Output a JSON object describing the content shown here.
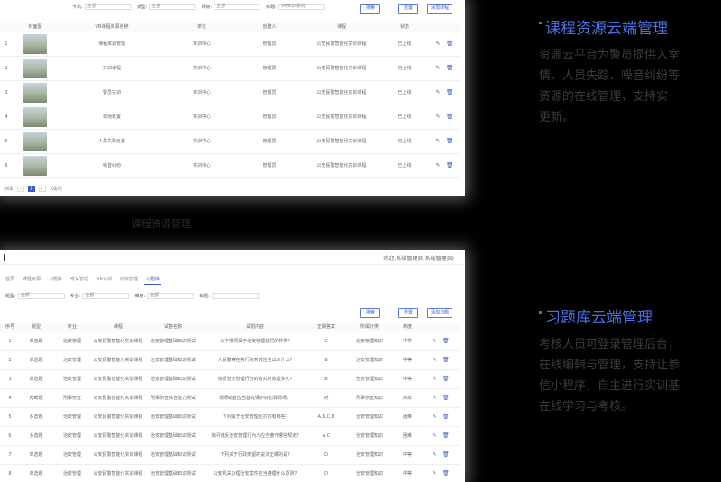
{
  "shot1": {
    "filters": [
      {
        "label": "卡机:",
        "value": "全部"
      },
      {
        "label": "类型:",
        "value": "全部"
      },
      {
        "label": "评级:",
        "value": "全部"
      },
      {
        "label": "标题:",
        "value": "VR实训系统"
      }
    ],
    "buttons": [
      "搜索",
      "重置",
      "添加课程"
    ],
    "columns": [
      "",
      "封面图",
      "VR课程资源名称",
      "单位",
      "创建人",
      "课程",
      "状态",
      ""
    ],
    "rows": [
      {
        "no": "1",
        "name": "课程资源管理",
        "unit": "实训中心",
        "creator": "管理员",
        "course": "公安民警智能化实训课程",
        "status": "已上线"
      },
      {
        "no": "2",
        "name": "实训课程",
        "unit": "实训中心",
        "creator": "管理员",
        "course": "公安民警智能化实训课程",
        "status": "已上线"
      },
      {
        "no": "3",
        "name": "警员实训",
        "unit": "实训中心",
        "creator": "管理员",
        "course": "公安民警智能化实训课程",
        "status": "已上线"
      },
      {
        "no": "4",
        "name": "现场处置",
        "unit": "实训中心",
        "creator": "管理员",
        "course": "公安民警智能化实训课程",
        "status": "已上线"
      },
      {
        "no": "5",
        "name": "人员失踪处置",
        "unit": "实训中心",
        "creator": "管理员",
        "course": "公安民警智能化实训课程",
        "status": "已上线"
      },
      {
        "no": "6",
        "name": "噪音纠纷",
        "unit": "实训中心",
        "creator": "管理员",
        "course": "公安民警智能化实训课程",
        "status": "已上线"
      }
    ],
    "pager": {
      "total": "共6条",
      "page": "1",
      "size": "10条/页"
    }
  },
  "caption": "课程资源管理",
  "shot2": {
    "user": "欢迎,系统管理员(系统管理员)",
    "tabs": [
      "首页",
      "课程资源",
      "习题库",
      "考试管理",
      "VR实训",
      "成绩管理",
      "习题库"
    ],
    "filters": [
      {
        "label": "题型:",
        "value": "全部"
      },
      {
        "label": "专业:",
        "value": "全部"
      },
      {
        "label": "难度:",
        "value": "全部"
      },
      {
        "label": "标题:",
        "value": ""
      }
    ],
    "buttons": [
      "搜索",
      "重置",
      "添加习题"
    ],
    "columns": [
      "序号",
      "题型",
      "专业",
      "课程",
      "试卷名称",
      "试题内容",
      "正确答案",
      "所属分类",
      "难度",
      ""
    ],
    "rows": [
      {
        "no": "1",
        "type": "单选题",
        "major": "治安管理",
        "course": "公安民警智能化实训课程",
        "paper": "治安管理基础知识测试",
        "content": "以下哪项属于治安管理处罚的种类?",
        "answer": "C",
        "cat": "治安管理知识",
        "level": "中等"
      },
      {
        "no": "2",
        "type": "单选题",
        "major": "治安管理",
        "course": "公安民警智能化实训课程",
        "paper": "治安管理基础知识测试",
        "content": "人民警察在执行职务时应当出示什么?",
        "answer": "B",
        "cat": "治安管理知识",
        "level": "中等"
      },
      {
        "no": "3",
        "type": "单选题",
        "major": "治安管理",
        "course": "公安民警智能化实训课程",
        "paper": "治安管理基础知识测试",
        "content": "违反治安管理行为的追究时效是多久?",
        "answer": "B",
        "cat": "治安管理知识",
        "level": "中等"
      },
      {
        "no": "4",
        "type": "判断题",
        "major": "刑事侦查",
        "course": "公安民警智能化实训课程",
        "paper": "刑事侦查综合能力测试",
        "content": "现场勘查应当首先保护好犯罪现场。",
        "answer": "对",
        "cat": "刑事侦查知识",
        "level": "简单"
      },
      {
        "no": "5",
        "type": "多选题",
        "major": "治安管理",
        "course": "公安民警智能化实训课程",
        "paper": "治安管理基础知识测试",
        "content": "下列属于治安管理处罚的有哪些?",
        "answer": "A,B,C,D",
        "cat": "治安管理知识",
        "level": "困难"
      },
      {
        "no": "6",
        "type": "多选题",
        "major": "治安管理",
        "course": "公安民警智能化实训课程",
        "paper": "治安管理基础知识测试",
        "content": "询问违反治安管理行为人应当遵守哪些规定?",
        "answer": "A,C",
        "cat": "治安管理知识",
        "level": "困难"
      },
      {
        "no": "7",
        "type": "单选题",
        "major": "治安管理",
        "course": "公安民警智能化实训课程",
        "paper": "治安管理基础知识测试",
        "content": "下列关于行政拘留的说法正确的是?",
        "answer": "D",
        "cat": "治安管理知识",
        "level": "中等"
      },
      {
        "no": "8",
        "type": "单选题",
        "major": "治安管理",
        "course": "公安民警智能化实训课程",
        "paper": "治安管理基础知识测试",
        "content": "公安机关办理治安案件应当遵循什么原则?",
        "answer": "D",
        "cat": "治安管理知识",
        "level": "中等"
      }
    ]
  },
  "sections": [
    {
      "title": "课程资源云端管理",
      "lines": [
        "资源云平台为警员提供入室",
        "情、人员失踪、噪音纠纷等",
        "资源的在线管理，支持实",
        "更新。"
      ]
    },
    {
      "title": "习题库云端管理",
      "lines": [
        "考核人员可登录管理后台，",
        "在线编辑与管理，支持让参",
        "信小程序，自主进行实训基",
        "在线学习与考核。"
      ]
    }
  ],
  "colors": {
    "accent": "#4a6fe0",
    "background": "#000000"
  }
}
